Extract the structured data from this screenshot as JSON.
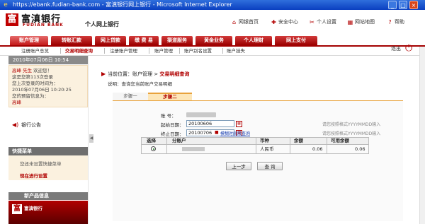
{
  "window": {
    "title": "https://ebank.fudian-bank.com - 富滇银行网上银行 - Microsoft Internet Explorer"
  },
  "brand": {
    "logo_cn": "富滇银行",
    "logo_en": "FUDIAN BANK",
    "logo_glyph": "富",
    "site_name": "个人网上银行"
  },
  "top_links": [
    {
      "label": "网银首页",
      "icon": "home-icon",
      "glyph": "⌂"
    },
    {
      "label": "安全中心",
      "icon": "shield-icon",
      "glyph": "✚"
    },
    {
      "label": "个人设置",
      "icon": "tools-icon",
      "glyph": "✂"
    },
    {
      "label": "网站地图",
      "icon": "sitemap-icon",
      "glyph": "▦"
    },
    {
      "label": "帮助",
      "icon": "help-icon",
      "glyph": "?"
    }
  ],
  "nav_tabs": [
    {
      "label": "账户管理",
      "active": true
    },
    {
      "label": "转账汇款",
      "active": false
    },
    {
      "label": "网上贷款",
      "active": false
    },
    {
      "label": "缴 费 易",
      "active": false
    },
    {
      "label": "渠道服务",
      "active": false
    },
    {
      "label": "黄金业务",
      "active": false
    },
    {
      "label": "个人理财",
      "active": false
    },
    {
      "label": "网上支付",
      "active": false
    }
  ],
  "sub_nav": [
    {
      "label": "注册账户总览",
      "active": false
    },
    {
      "label": "交易明细查询",
      "active": true
    },
    {
      "label": "注册账户管理",
      "active": false
    },
    {
      "label": "账户管理",
      "active": false
    },
    {
      "label": "账户别名设置",
      "active": false
    },
    {
      "label": "账户挂失",
      "active": false
    }
  ],
  "logout": {
    "label": "退出"
  },
  "sidebar": {
    "date": "2010年07月06日  10:54",
    "welcome": {
      "user": "高峰 先生",
      "greeting": " 欢迎您！",
      "line2": "这是您第113次登录",
      "line3": "您上次登录的时间为：",
      "line4": "2010年07月06日 10:20:25",
      "line5": "您的预留信息为：",
      "reserved_info": "高峰"
    },
    "notice": "银行公告",
    "quick_title": "快捷菜单",
    "quick_text": "您还未设置快捷菜单",
    "quick_link": "现在进行设置",
    "news_title": "新产品信息",
    "promo_text": "富滇银行"
  },
  "main": {
    "breadcrumb_prefix": "当前位置：账户管理 > ",
    "breadcrumb_current": "交易明细查询",
    "instruction": "说明：查询您当前账户交易明细",
    "step1": "步骤一",
    "step2": "步骤二",
    "form": {
      "account_label": "账    号：",
      "start_label": "起始日期：",
      "start_value": "20100606",
      "end_label": "终止日期：",
      "end_value": "20100706",
      "hint_start": "请您按照格式YYYYMMDD输入",
      "hint_end": "请您按照格式YYYYMMDD输入",
      "help_link": "模糊时间段查询"
    },
    "grid": {
      "headers": [
        "选择",
        "分账户",
        "币种",
        "余额",
        "可用余额"
      ],
      "row": {
        "currency": "人民币",
        "balance": "0.06",
        "available": "0.06"
      }
    },
    "buttons": {
      "prev": "上一步",
      "query": "查 询"
    }
  }
}
